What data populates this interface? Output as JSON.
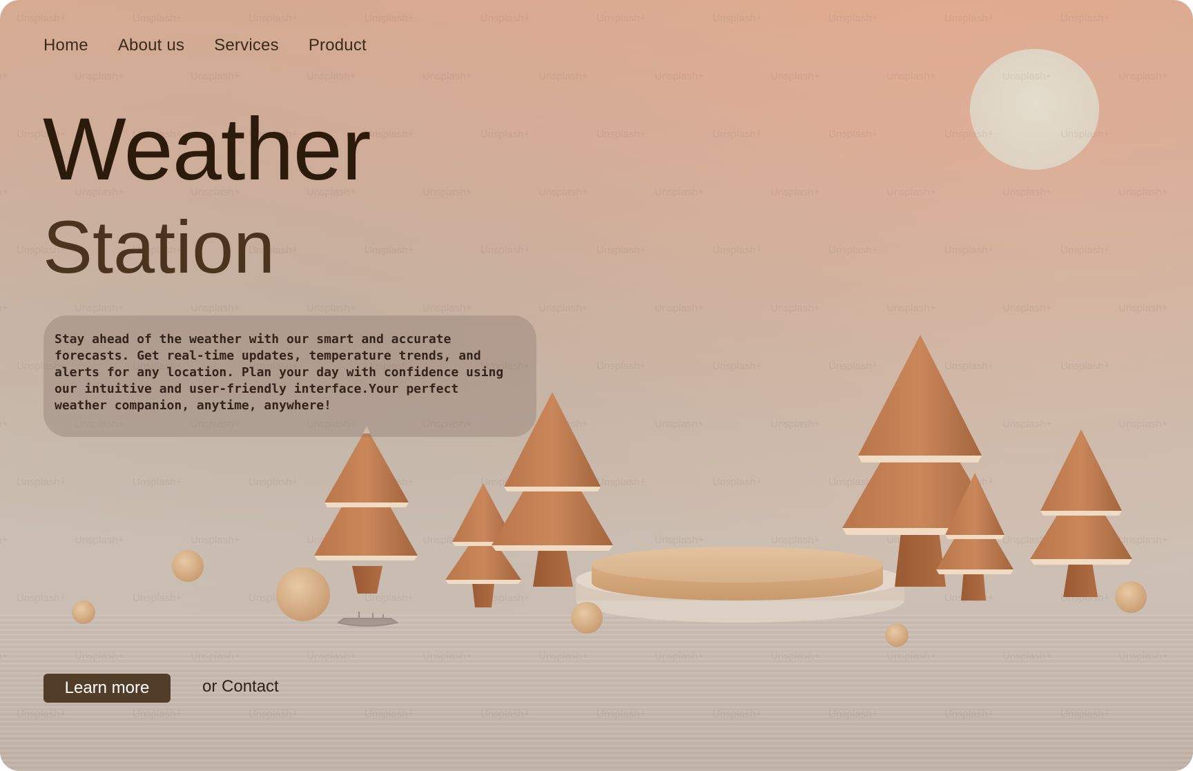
{
  "nav": {
    "items": [
      "Home",
      "About us",
      "Services",
      "Product"
    ]
  },
  "hero": {
    "title_line1": "Weather",
    "title_line2": "Station",
    "description": "Stay ahead of the weather with our smart and accurate forecasts. Get real-time updates, temperature trends, and alerts for any location. Plan your day with confidence using our intuitive and user-friendly interface.Your perfect weather companion, anytime, anywhere!"
  },
  "actions": {
    "learn_more": "Learn more",
    "contact": "or Contact"
  },
  "background": {
    "watermark_text": "Unsplash+",
    "scene_description_icons": [
      "sun-icon",
      "tree-icon",
      "podium-icon",
      "sphere-icon",
      "boat-icon"
    ]
  },
  "colors": {
    "button_bg": "#523d28",
    "title": "#2c1b0a",
    "subtitle": "#4a3420",
    "description_panel": "#7d695f"
  }
}
